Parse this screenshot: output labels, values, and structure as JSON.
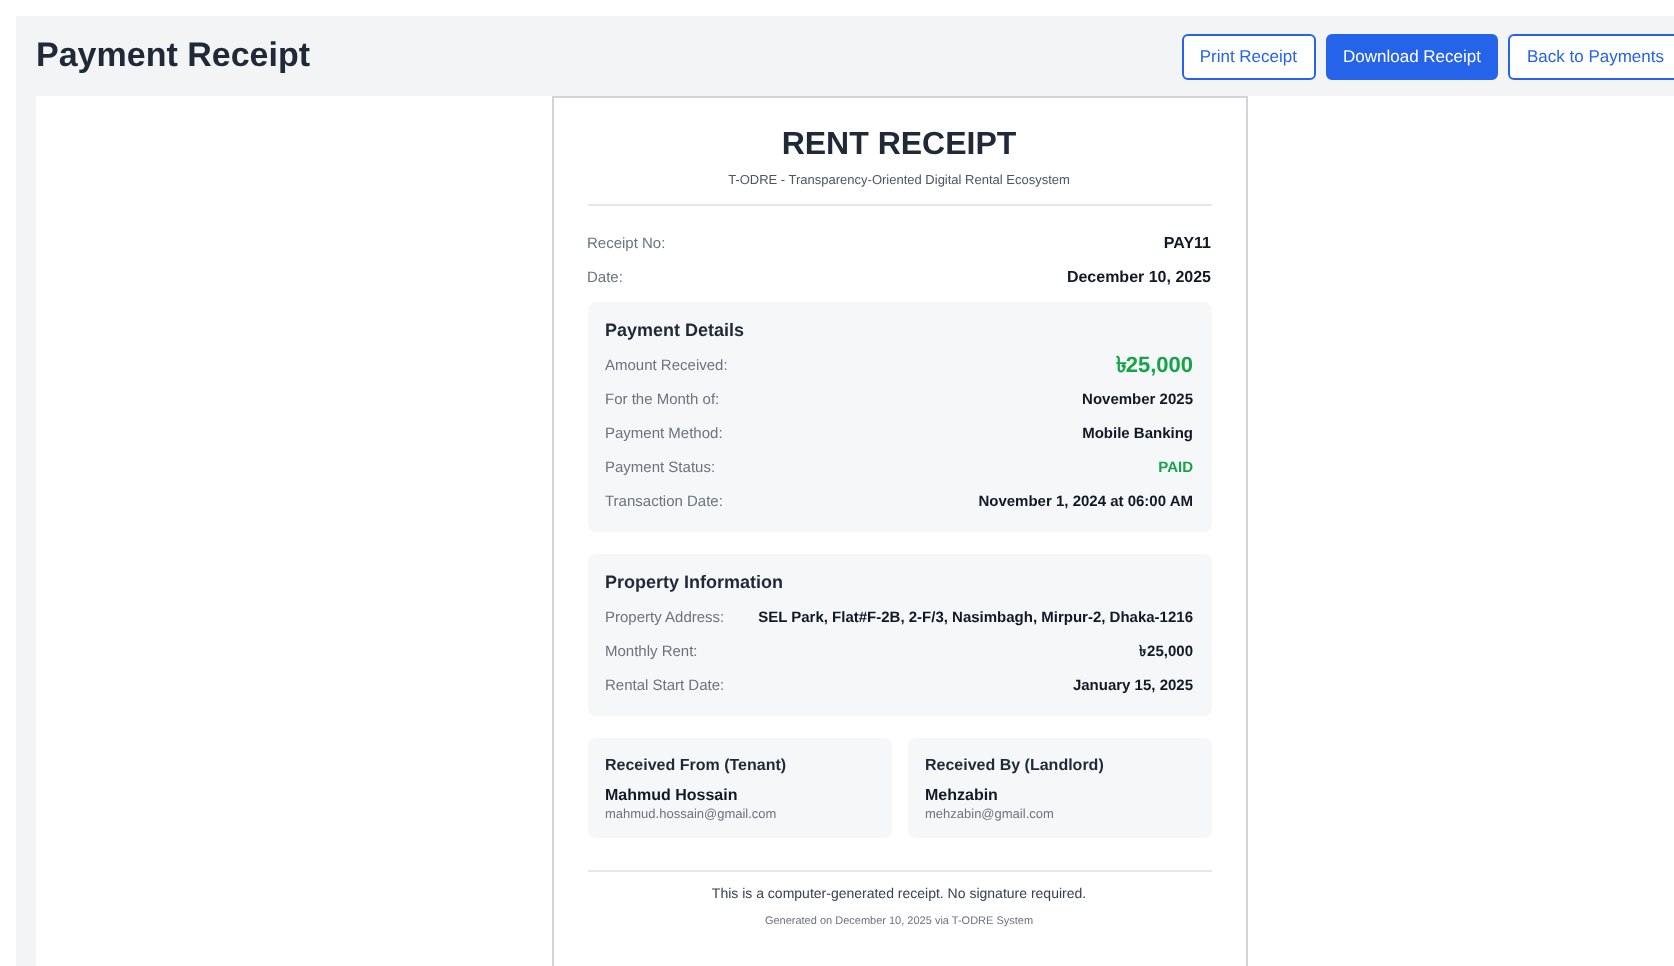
{
  "page": {
    "title": "Payment Receipt"
  },
  "actions": [
    {
      "label": "Print Receipt",
      "kind": "outline"
    },
    {
      "label": "Download Receipt",
      "kind": "primary"
    },
    {
      "label": "Back to Payments",
      "kind": "outline"
    }
  ],
  "receipt": {
    "title": "RENT RECEIPT",
    "subtitle": "T-ODRE - Transparency-Oriented Digital Rental Ecosystem",
    "meta": [
      {
        "label": "Receipt No:",
        "value": "PAY11"
      },
      {
        "label": "Date:",
        "value": "December 10, 2025"
      }
    ],
    "sections": [
      {
        "title": "Payment Details",
        "rows": [
          {
            "label": "Amount Received:",
            "value": "৳25,000",
            "kind": "amount"
          },
          {
            "label": "For the Month of:",
            "value": "November 2025",
            "kind": "plain"
          },
          {
            "label": "Payment Method:",
            "value": "Mobile Banking",
            "kind": "plain"
          },
          {
            "label": "Payment Status:",
            "value": "PAID",
            "kind": "status"
          },
          {
            "label": "Transaction Date:",
            "value": "November 1, 2024 at 06:00 AM",
            "kind": "plain"
          }
        ]
      },
      {
        "title": "Property Information",
        "rows": [
          {
            "label": "Property Address:",
            "value": "SEL Park, Flat#F-2B, 2-F/3, Nasimbagh, Mirpur-2, Dhaka-1216",
            "kind": "plain"
          },
          {
            "label": "Monthly Rent:",
            "value": "৳25,000",
            "kind": "plain"
          },
          {
            "label": "Rental Start Date:",
            "value": "January 15, 2025",
            "kind": "plain"
          }
        ]
      }
    ],
    "parties": [
      {
        "title": "Received From (Tenant)",
        "name": "Mahmud Hossain",
        "email": "mahmud.hossain@gmail.com"
      },
      {
        "title": "Received By (Landlord)",
        "name": "Mehzabin",
        "email": "mehzabin@gmail.com"
      }
    ],
    "footer": {
      "note": "This is a computer-generated receipt. No signature required.",
      "generated": "Generated on December 10, 2025 via T-ODRE System"
    }
  }
}
